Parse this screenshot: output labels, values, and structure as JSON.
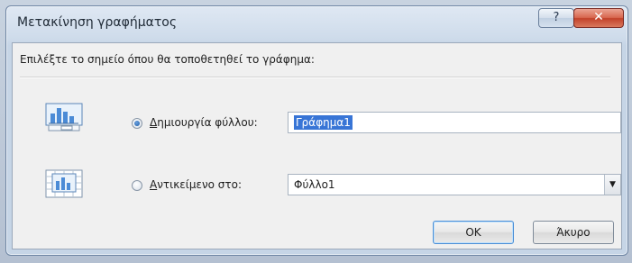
{
  "window": {
    "title": "Μετακίνηση γραφήματος",
    "help_label": "?",
    "close_label": "✕"
  },
  "dialog": {
    "prompt": "Επιλέξτε το σημείο όπου θα τοποθετηθεί το γράφημα:",
    "new_sheet": {
      "label_underlined": "Δ",
      "label_rest": "ημιουργία φύλλου:",
      "value": "Γράφημα1",
      "selected": true,
      "icon": "new-chart-sheet-icon"
    },
    "object_in": {
      "label_underlined": "Α",
      "label_rest": "ντικείμενο στο:",
      "value": "Φύλλο1",
      "selected": false,
      "icon": "embedded-chart-icon"
    },
    "ok_label": "OK",
    "cancel_label": "Άκυρο"
  }
}
